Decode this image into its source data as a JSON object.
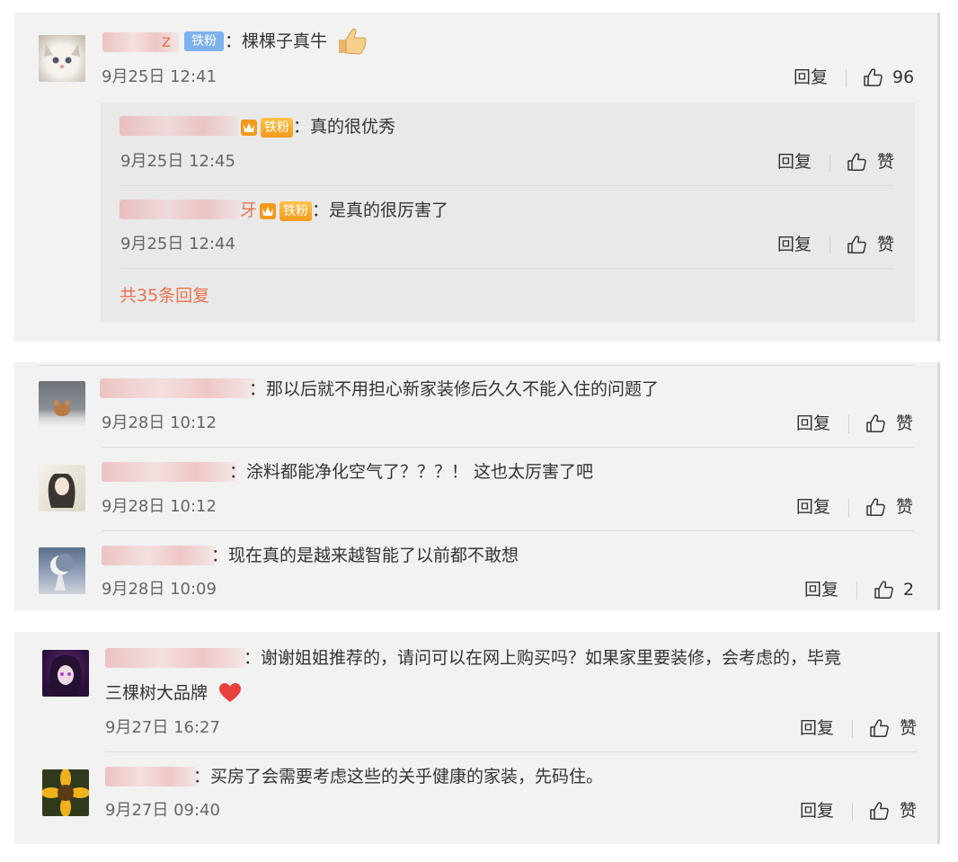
{
  "colors": {
    "accent": "#eb7350",
    "badge_blue": "#7db1eb",
    "badge_orange": "#f39a1c"
  },
  "panel1": {
    "comment": {
      "name_tail": "z",
      "badge": "铁粉",
      "text": "：棵棵子真牛",
      "emoji": "thumbs-up-emoji",
      "time": "9月25日 12:41",
      "reply": "回复",
      "likes": "96"
    },
    "subreplies": [
      {
        "badge": "铁粉",
        "text": "：真的很优秀",
        "time": "9月25日 12:45",
        "reply": "回复",
        "likes": "赞"
      },
      {
        "name_tail": "牙",
        "badge": "铁粉",
        "text": "：是真的很厉害了",
        "time": "9月25日 12:44",
        "reply": "回复",
        "likes": "赞"
      }
    ],
    "more_replies": "共35条回复"
  },
  "panel2": {
    "comments": [
      {
        "text": "：那以后就不用担心新家装修后久久不能入住的问题了",
        "time": "9月28日 10:12",
        "reply": "回复",
        "likes": "赞"
      },
      {
        "text": "：涂料都能净化空气了？？？！ 这也太厉害了吧",
        "time": "9月28日 10:12",
        "reply": "回复",
        "likes": "赞"
      },
      {
        "text": "：现在真的是越来越智能了以前都不敢想",
        "time": "9月28日 10:09",
        "reply": "回复",
        "likes": "2"
      }
    ]
  },
  "panel3": {
    "comments": [
      {
        "text": "：谢谢姐姐推荐的，请问可以在网上购买吗？如果家里要装修，会考虑的，毕竟",
        "text2": "三棵树大品牌",
        "emoji": "heart-emoji",
        "time": "9月27日 16:27",
        "reply": "回复",
        "likes": "赞"
      },
      {
        "text": "：买房了会需要考虑这些的关乎健康的家装，先码住。",
        "time": "9月27日 09:40",
        "reply": "回复",
        "likes": "赞"
      }
    ]
  }
}
